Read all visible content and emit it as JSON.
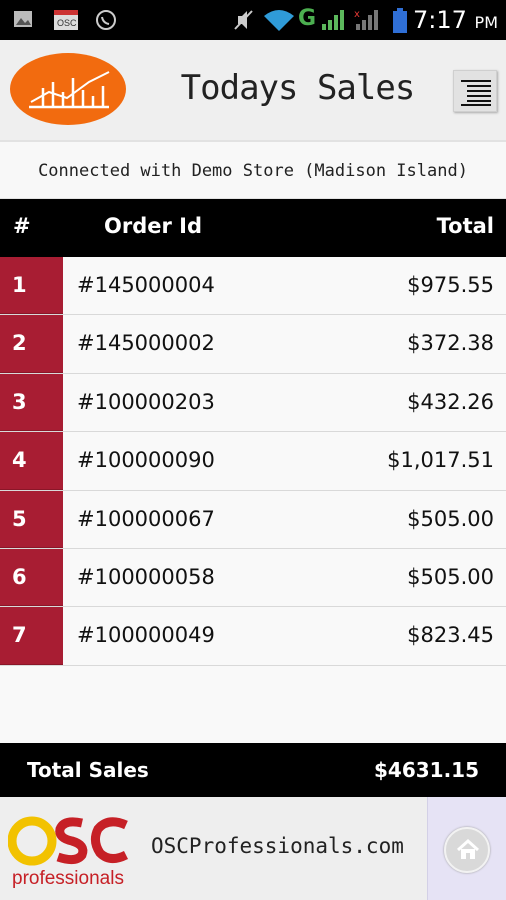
{
  "status_bar": {
    "time": "7:17",
    "ampm": "PM",
    "network": "G",
    "icons": [
      "image-icon",
      "osc-app-icon",
      "whatsapp-icon",
      "mute-icon",
      "wifi-icon",
      "signal-icon",
      "signal-icon-no-sim",
      "battery-icon"
    ]
  },
  "header": {
    "title": "Todays Sales",
    "logo_icon": "sales-chart-logo",
    "menu_icon": "menu-icon"
  },
  "connection": {
    "text": "Connected with Demo Store (Madison Island)"
  },
  "table": {
    "columns": {
      "num": "#",
      "order_id": "Order Id",
      "total": "Total"
    },
    "rows": [
      {
        "num": "1",
        "order_id": "#145000004",
        "total": "$975.55"
      },
      {
        "num": "2",
        "order_id": "#145000002",
        "total": "$372.38"
      },
      {
        "num": "3",
        "order_id": "#100000203",
        "total": "$432.26"
      },
      {
        "num": "4",
        "order_id": "#100000090",
        "total": "$1,017.51"
      },
      {
        "num": "5",
        "order_id": "#100000067",
        "total": "$505.00"
      },
      {
        "num": "6",
        "order_id": "#100000058",
        "total": "$505.00"
      },
      {
        "num": "7",
        "order_id": "#100000049",
        "total": "$823.45"
      }
    ]
  },
  "totals": {
    "label": "Total Sales",
    "value": "$4631.15"
  },
  "footer": {
    "brand_logo_text": "OSC professionals",
    "site": "OSCProfessionals.com",
    "home_icon": "home-icon"
  },
  "colors": {
    "accent_red": "#a81d33",
    "logo_orange": "#f26b0f",
    "black": "#000000"
  }
}
